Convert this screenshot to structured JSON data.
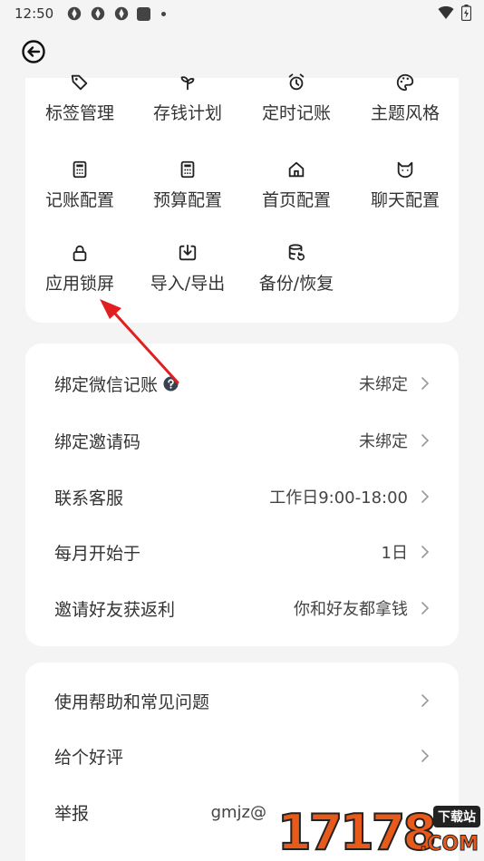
{
  "status_bar": {
    "time": "12:50"
  },
  "features": [
    {
      "label": "标签管理",
      "icon": "tag-icon"
    },
    {
      "label": "存钱计划",
      "icon": "sprout-icon"
    },
    {
      "label": "定时记账",
      "icon": "alarm-clock-icon"
    },
    {
      "label": "主题风格",
      "icon": "palette-icon"
    },
    {
      "label": "记账配置",
      "icon": "calculator-icon"
    },
    {
      "label": "预算配置",
      "icon": "calculator-icon"
    },
    {
      "label": "首页配置",
      "icon": "home-icon"
    },
    {
      "label": "聊天配置",
      "icon": "cat-icon"
    },
    {
      "label": "应用锁屏",
      "icon": "lock-icon"
    },
    {
      "label": "导入/导出",
      "icon": "download-box-icon"
    },
    {
      "label": "备份/恢复",
      "icon": "database-restore-icon"
    }
  ],
  "settings": [
    {
      "label": "绑定微信记账",
      "value": "未绑定",
      "has_help": true
    },
    {
      "label": "绑定邀请码",
      "value": "未绑定"
    },
    {
      "label": "联系客服",
      "value": "工作日9:00-18:00"
    },
    {
      "label": "每月开始于",
      "value": "1日"
    },
    {
      "label": "邀请好友获返利",
      "value": "你和好友都拿钱"
    }
  ],
  "help_rows": [
    {
      "label": "使用帮助和常见问题",
      "value": ""
    },
    {
      "label": "给个好评",
      "value": ""
    },
    {
      "label": "举报",
      "value": "gmjz@"
    }
  ],
  "watermark": {
    "number": "17178",
    "badge": "下载站",
    "suffix": ".COM"
  },
  "colors": {
    "accent_arrow": "#e02020",
    "card": "#ffffff",
    "background": "#f4f4f4"
  }
}
